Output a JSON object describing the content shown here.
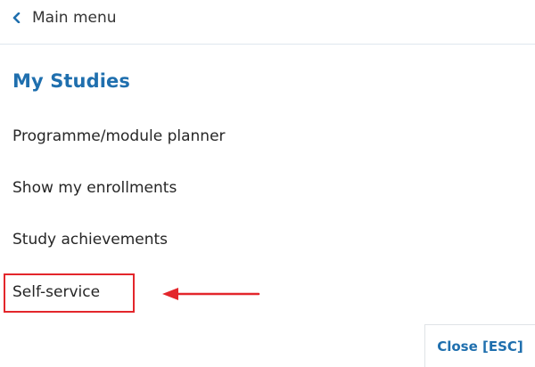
{
  "back_link": {
    "label": "Main menu",
    "icon": "chevron-left-icon"
  },
  "section": {
    "title": "My Studies"
  },
  "menu_items": [
    {
      "label": "Programme/module planner"
    },
    {
      "label": "Show my enrollments"
    },
    {
      "label": "Study achievements"
    },
    {
      "label": "Self-service"
    }
  ],
  "close_button": {
    "label": "Close [ESC]"
  },
  "colors": {
    "accent": "#1f6fae",
    "annotation": "#e3262b",
    "text": "#262626",
    "divider": "#dfe7ee"
  }
}
